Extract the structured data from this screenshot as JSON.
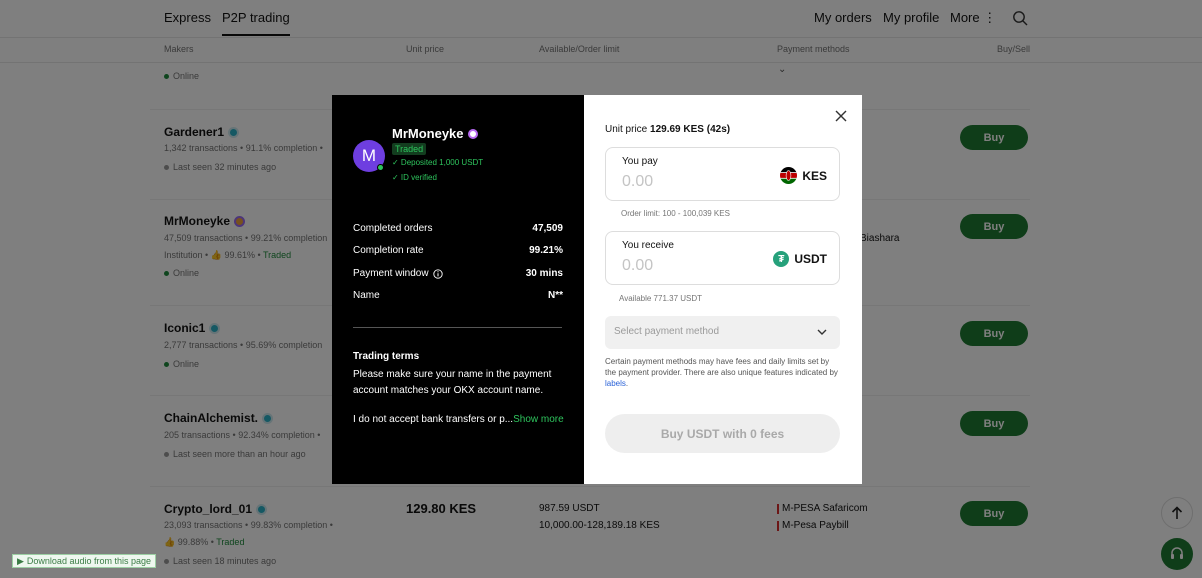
{
  "nav": {
    "tabs": [
      "Express",
      "P2P trading"
    ],
    "right": [
      "My orders",
      "My profile",
      "More"
    ]
  },
  "columns": [
    "Makers",
    "Unit price",
    "Available/Order limit",
    "Payment methods",
    "Buy/Sell"
  ],
  "list": {
    "row0_status": "Online",
    "rows": [
      {
        "name": "Gardener1",
        "stats": "1,342 transactions  •  91.1% completion  •",
        "status": "Last seen 32 minutes ago",
        "buy": "Buy"
      },
      {
        "name": "MrMoneyke",
        "stats": "47,509 transactions  •  99.21% completion",
        "sub": "Institution  •",
        "like": "99.61%",
        "traded": "Traded",
        "status": "Online",
        "payment": "Biashara",
        "buy": "Buy"
      },
      {
        "name": "Iconic1",
        "stats": "2,777 transactions  •  95.69% completion",
        "status": "Online",
        "buy": "Buy"
      },
      {
        "name": "ChainAlchemist.",
        "stats": "205 transactions  •  92.34% completion  •",
        "status": "Last seen more than an hour ago",
        "buy": "Buy"
      },
      {
        "name": "Crypto_lord_01",
        "stats": "23,093 transactions  •  99.83% completion  •",
        "like": "99.88%",
        "traded": "Traded",
        "status": "Last seen 18 minutes ago",
        "price": "129.80 KES",
        "available": "987.59 USDT",
        "limit": "10,000.00-128,189.18 KES",
        "payments": [
          "M-PESA Safaricom",
          "M-Pesa Paybill"
        ],
        "buy": "Buy"
      }
    ]
  },
  "download_bar": "Download audio from this page",
  "modal": {
    "maker": {
      "avatar_letter": "M",
      "name": "MrMoneyke",
      "traded": "Traded",
      "deposited": "✓ Deposited 1,000 USDT",
      "id_verified": "✓ ID verified"
    },
    "stats": [
      {
        "label": "Completed orders",
        "value": "47,509"
      },
      {
        "label": "Completion rate",
        "value": "99.21%"
      },
      {
        "label": "Payment window",
        "value": "30 mins"
      },
      {
        "label": "Name",
        "value": "N**"
      }
    ],
    "terms": {
      "title": "Trading terms",
      "body": "Please make sure your name in the payment account matches your OKX account name.",
      "more_text": "I do not accept bank transfers or p...",
      "show_more": "Show more"
    },
    "unit_price_label": "Unit price",
    "unit_price_value": "129.69 KES (42s)",
    "pay": {
      "label": "You pay",
      "placeholder": "0.00",
      "currency": "KES",
      "hint": "Order limit: 100 - 100,039 KES"
    },
    "receive": {
      "label": "You receive",
      "placeholder": "0.00",
      "currency": "USDT",
      "hint": "Available 771.37 USDT"
    },
    "select_placeholder": "Select payment method",
    "note_text": "Certain payment methods may have fees and daily limits set by the payment provider. There are also unique features indicated by ",
    "note_link": "labels",
    "note_end": ".",
    "buy_button": "Buy USDT with 0 fees"
  }
}
